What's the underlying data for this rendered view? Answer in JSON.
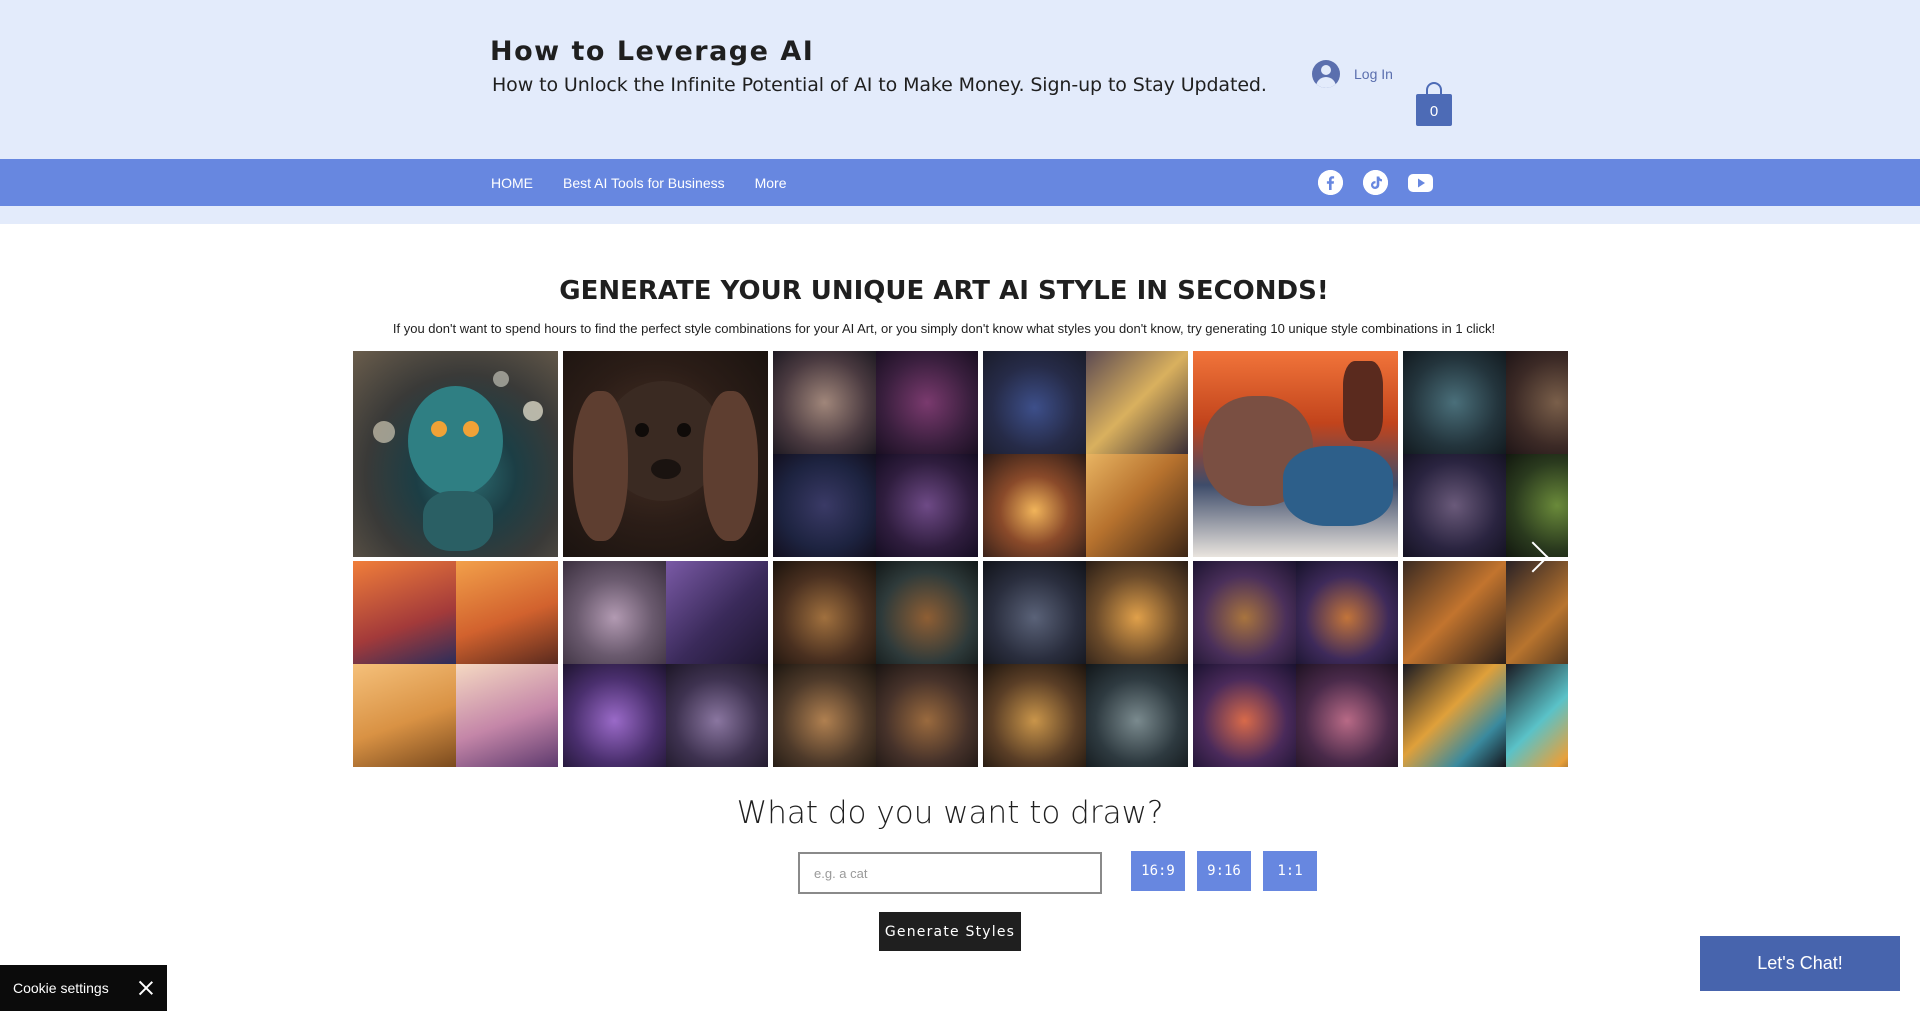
{
  "header": {
    "title": "How to Leverage AI",
    "tagline": "How to Unlock the Infinite Potential of AI to Make Money. Sign-up to Stay Updated.",
    "login_label": "Log In",
    "cart_count": "0"
  },
  "nav": {
    "items": [
      "HOME",
      "Best AI Tools for Business",
      "More"
    ],
    "social": [
      "facebook-icon",
      "tiktok-icon",
      "youtube-icon"
    ]
  },
  "main": {
    "heading": "GENERATE YOUR UNIQUE ART AI STYLE IN SECONDS!",
    "subtext": "If you don't want to spend hours to find the perfect style combinations for your AI Art, or you simply don't know what styles you don't know, try generating 10 unique style combinations in 1 click!",
    "draw_question": "What do you want to draw?",
    "prompt_placeholder": "e.g. a cat",
    "ratios": [
      "16:9",
      "9:16",
      "1:1"
    ],
    "generate_label": "Generate Styles"
  },
  "gallery_images": [
    "teal-cat-sculpture",
    "spaniel-portrait",
    "spaniel-grid-purple",
    "origami-cats-grid",
    "papercut-cat-landscape",
    "mechanical-dogs-grid",
    "spaniels-sunset-grid",
    "purple-spaniels-grid",
    "plush-puppies-grid",
    "cinematic-cats-grid",
    "colorful-spaniels-grid",
    "geometric-dogs-grid"
  ],
  "chat_label": "Let's Chat!",
  "cookie_label": "Cookie settings",
  "colors": {
    "header_bg": "#e3ebfb",
    "nav_bg": "#6787e0",
    "accent": "#4d6bb6",
    "chat_bg": "#4764ad",
    "dark": "#1f1f1f"
  }
}
